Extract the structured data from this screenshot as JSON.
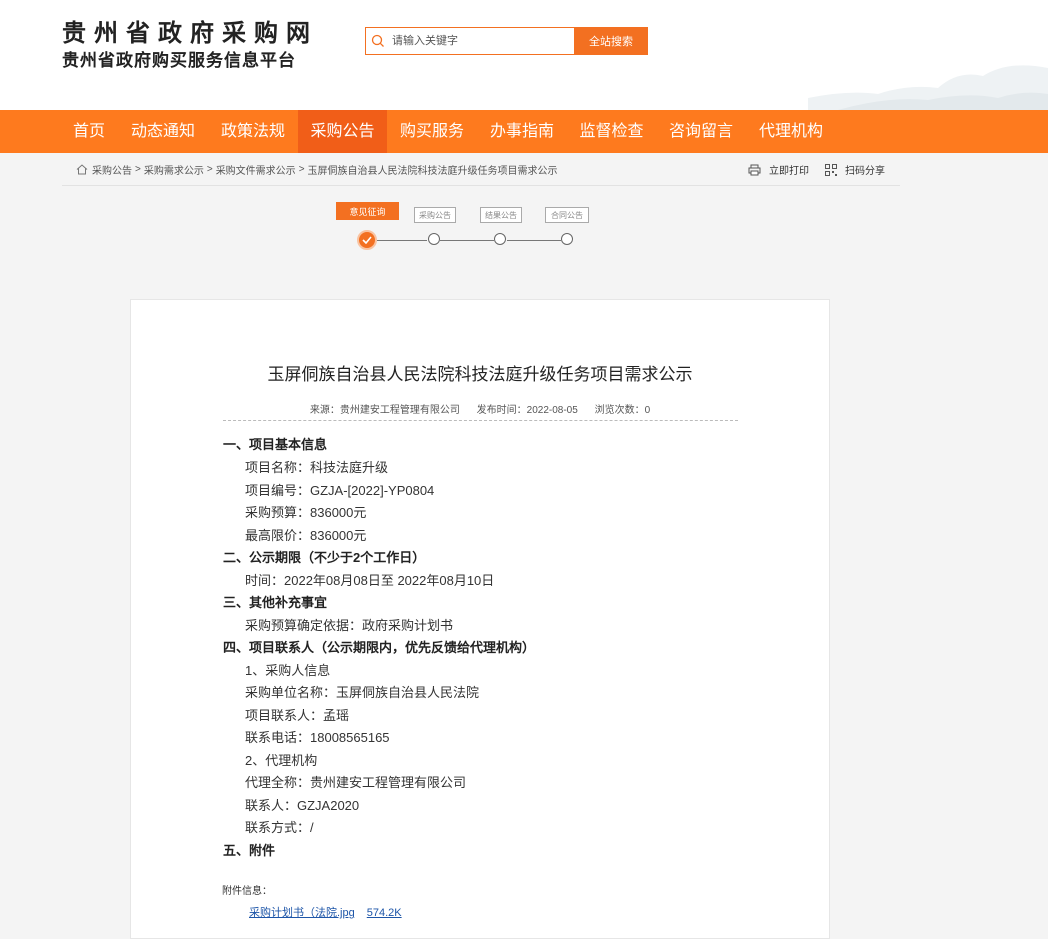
{
  "site": {
    "title": "贵州省政府采购网",
    "subtitle": "贵州省政府购买服务信息平台"
  },
  "search": {
    "placeholder": "请输入关键字",
    "button_label": "全站搜索"
  },
  "nav": {
    "items": [
      "首页",
      "动态通知",
      "政策法规",
      "采购公告",
      "购买服务",
      "办事指南",
      "监督检查",
      "咨询留言",
      "代理机构"
    ],
    "active_index": 3
  },
  "breadcrumb": {
    "items": [
      "采购公告",
      "采购需求公示",
      "采购文件需求公示",
      "玉屏侗族自治县人民法院科技法庭升级任务项目需求公示"
    ],
    "separator": ">"
  },
  "tools": {
    "print_label": "立即打印",
    "share_label": "扫码分享"
  },
  "steps": {
    "labels": [
      "意见征询",
      "采购公告",
      "结果公告",
      "合同公告"
    ],
    "current_index": 0
  },
  "article": {
    "title": "玉屏侗族自治县人民法院科技法庭升级任务项目需求公示",
    "source": "来源：贵州建安工程管理有限公司",
    "publish_time": "发布时间：2022-08-05",
    "views": "浏览次数：0",
    "lines": [
      {
        "text": "一、项目基本信息",
        "heading": true
      },
      {
        "text": "项目名称：科技法庭升级",
        "heading": false
      },
      {
        "text": "项目编号：GZJA-[2022]-YP0804",
        "heading": false
      },
      {
        "text": "采购预算：836000元",
        "heading": false
      },
      {
        "text": "最高限价：836000元",
        "heading": false
      },
      {
        "text": "二、公示期限（不少于2个工作日）",
        "heading": true
      },
      {
        "text": "时间：2022年08月08日至 2022年08月10日",
        "heading": false
      },
      {
        "text": "三、其他补充事宜",
        "heading": true
      },
      {
        "text": "采购预算确定依据：政府采购计划书",
        "heading": false
      },
      {
        "text": "四、项目联系人（公示期限内，优先反馈给代理机构）",
        "heading": true
      },
      {
        "text": "1、采购人信息",
        "heading": false
      },
      {
        "text": "采购单位名称：玉屏侗族自治县人民法院",
        "heading": false
      },
      {
        "text": "项目联系人：孟瑶",
        "heading": false
      },
      {
        "text": "联系电话：18008565165",
        "heading": false
      },
      {
        "text": "2、代理机构",
        "heading": false
      },
      {
        "text": "代理全称：贵州建安工程管理有限公司",
        "heading": false
      },
      {
        "text": "联系人：GZJA2020",
        "heading": false
      },
      {
        "text": "联系方式：/",
        "heading": false
      },
      {
        "text": "五、附件",
        "heading": true
      }
    ],
    "attachment_label": "附件信息：",
    "attachment": {
      "name": "采购计划书（法院.jpg",
      "size": "574.2K"
    }
  },
  "colors": {
    "brand_orange": "#fe7a1e",
    "active_nav": "#f15e18",
    "link_blue": "#1d55a8"
  }
}
